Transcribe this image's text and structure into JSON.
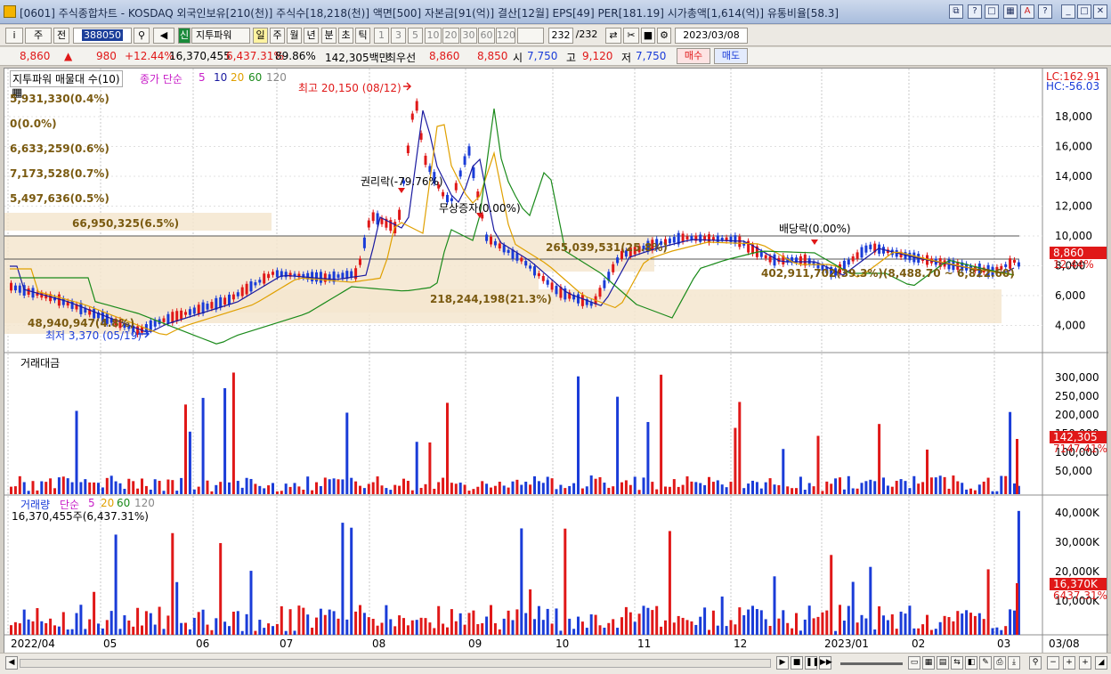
{
  "window": {
    "title": "[0601] 주식종합차트 - KOSDAQ 외국인보유[210(천)] 주식수[18,218(천)] 액면[500] 자본금[91(억)] 결산[12월] EPS[49] PER[181.19] 시가총액[1,614(억)] 유통비율[58.3]"
  },
  "toolbar": {
    "type": "주",
    "mode": "전",
    "code": "388050",
    "cat": "신",
    "indicator": "지투파워",
    "periods": [
      "일",
      "주",
      "월",
      "년",
      "분",
      "초",
      "틱"
    ],
    "minutes": [
      "1",
      "3",
      "5",
      "10",
      "20",
      "30",
      "60",
      "120"
    ],
    "count": "232",
    "total": "/232",
    "date": "2023/03/08"
  },
  "quote": {
    "price": "8,860",
    "change": "980",
    "rate": "+12.44%",
    "volume": "16,370,455",
    "vol_rate": "6,437.31%",
    "ratio": "89.86%",
    "amount": "142,305백만",
    "bid_label": "최우선",
    "bid": "8,860",
    "ask": "8,850",
    "open_label": "시",
    "open": "7,750",
    "high_label": "고",
    "high": "9,120",
    "low_label": "저",
    "low": "7,750",
    "buy": "매수",
    "sell": "매도"
  },
  "price_panel": {
    "legend_title": "지투파워 매물대 수(10)",
    "ma_label": "종가 단순",
    "ma_periods": [
      "5",
      "10",
      "20",
      "60",
      "120"
    ],
    "lc": "LC:162.91",
    "hc": "HC:-56.03",
    "cur_price": "8,860",
    "cur_rate": "12.44%",
    "high_note": "최고 20,150 (08/12)",
    "low_note": "최저 3,370 (05/19)",
    "event1": "권리락(-79.76%)",
    "event2": "무상증자(0.00%)",
    "event3": "배당락(0.00%)",
    "yticks": [
      "18,000",
      "16,000",
      "14,000",
      "12,000",
      "10,000",
      "8,000",
      "6,000",
      "4,000"
    ],
    "vp": [
      "5,931,330(0.4%)",
      "0(0.0%)",
      "6,633,259(0.6%)",
      "7,173,528(0.7%)",
      "5,497,636(0.5%)",
      "66,950,325(6.5%)"
    ],
    "vp_mid1": "265,039,531(25.8%)",
    "vp_mid2": "218,244,198(21.3%)",
    "vp_bottom": "48,940,947(4.8%)",
    "vp_range": "402,911,702(39.3%)(8,488.70 ~ 6,822.60)"
  },
  "amount_panel": {
    "title": "거래대금",
    "yticks": [
      "300,000",
      "250,000",
      "200,000",
      "150,000",
      "100,000",
      "50,000"
    ],
    "cur": "142,305",
    "cur_rate": "7147.41%"
  },
  "volume_panel": {
    "title": "거래량",
    "ma_label": "단순",
    "ma_periods": [
      "5",
      "20",
      "60",
      "120"
    ],
    "summary": "16,370,455주(6,437.31%)",
    "yticks": [
      "40,000K",
      "30,000K",
      "20,000K",
      "10,000K"
    ],
    "cur": "16,370K",
    "cur_rate": "6437.31%"
  },
  "xaxis": {
    "labels": [
      "2022/04",
      "05",
      "06",
      "07",
      "08",
      "09",
      "10",
      "11",
      "12",
      "2023/01",
      "02",
      "03",
      "03/08"
    ]
  },
  "colors": {
    "up": "#e01818",
    "down": "#1a3cd8",
    "ma5": "#c81ec8",
    "ma10": "#1a1aa0",
    "ma20": "#e0a000",
    "ma60": "#1a8a1a",
    "vp": "#f5e6cf"
  }
}
